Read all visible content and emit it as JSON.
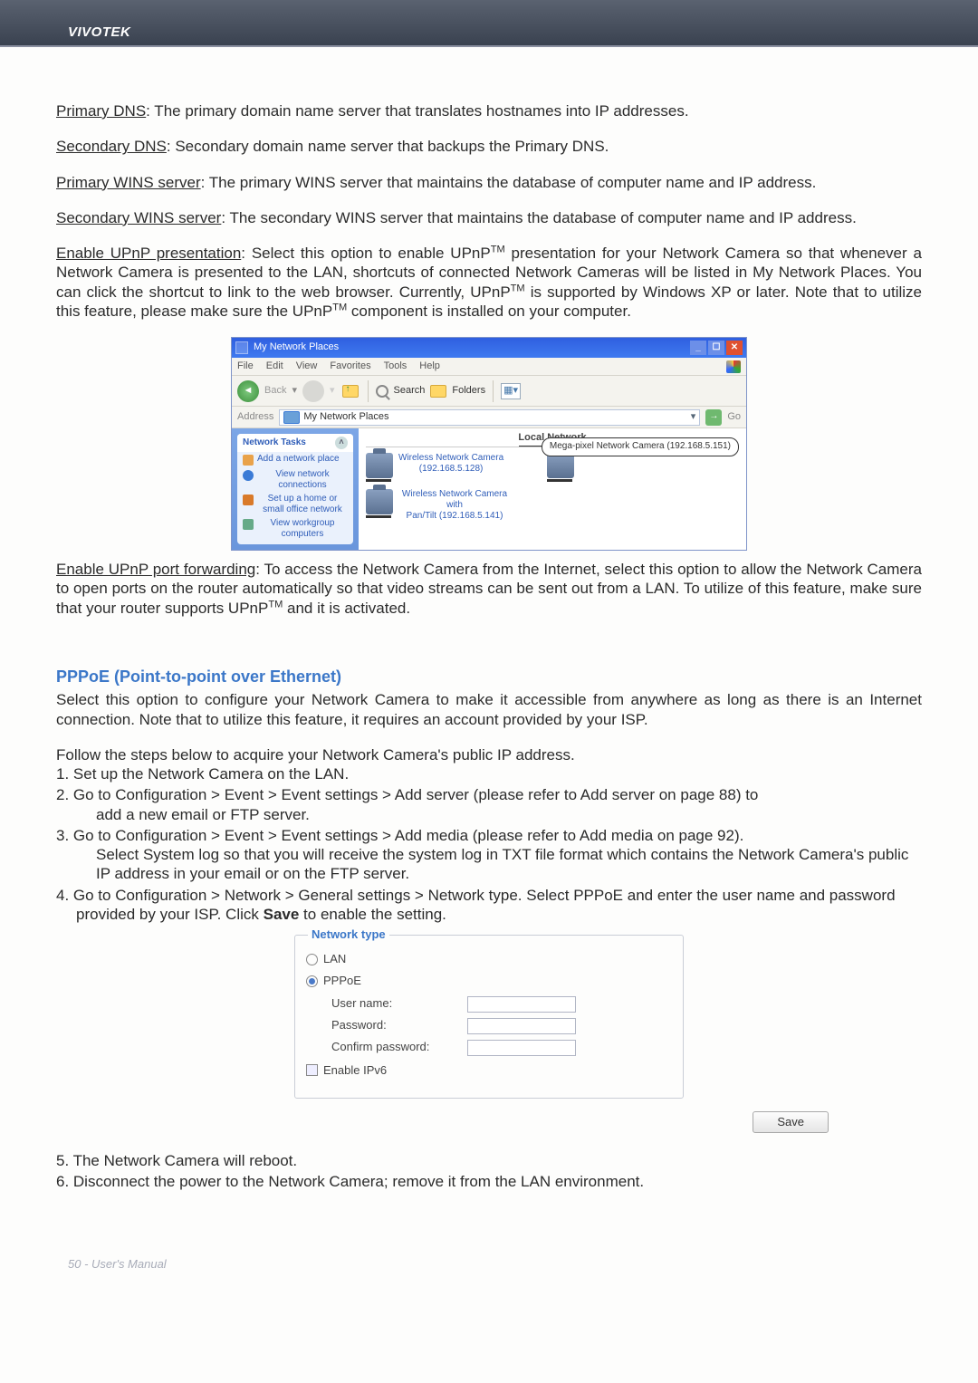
{
  "brand": "VIVOTEK",
  "paragraphs": {
    "primary_dns_label": "Primary DNS",
    "primary_dns_text": ": The primary domain name server that translates hostnames into IP addresses.",
    "secondary_dns_label": "Secondary DNS",
    "secondary_dns_text": ": Secondary domain name server that backups the Primary DNS.",
    "primary_wins_label": "Primary WINS server",
    "primary_wins_text": ": The primary WINS server that maintains the database of computer name and IP address.",
    "secondary_wins_label": "Secondary WINS server",
    "secondary_wins_text": ": The secondary WINS server that maintains the database of computer name and IP address.",
    "upnp_pres_label": "Enable UPnP presentation",
    "upnp_pres_text_a": ": Select this option to enable UPnP",
    "upnp_pres_text_b": " presentation for your Network Camera so that whenever a Network Camera is presented to the LAN, shortcuts of connected Network Cameras will be listed in My Network Places. You can click the shortcut to link to the web browser. Currently, UPnP",
    "upnp_pres_text_c": " is supported by Windows XP or later. Note that to utilize this feature, please make sure the UPnP",
    "upnp_pres_text_d": " component is installed on your computer.",
    "tm": "TM",
    "upnp_port_label": "Enable UPnP port forwarding",
    "upnp_port_text_a": ": To access the Network Camera from the Internet, select this option to allow the Network Camera to open ports on the router automatically so that video streams can be sent out from a LAN. To utilize of this feature, make sure that your router supports UPnP",
    "upnp_port_text_b": " and it is activated."
  },
  "pppoe": {
    "title": "PPPoE (Point-to-point over Ethernet)",
    "intro": "Select this option to configure your Network Camera to make it accessible from anywhere as long as there is an Internet connection. Note that to utilize this feature, it requires an account provided by your ISP.",
    "follow": "Follow the steps below to acquire your Network Camera's public IP address.",
    "steps": {
      "s1": "1. Set up the Network Camera on the LAN.",
      "s2a": "2. Go to Configuration > Event > Event settings > Add server (please refer to Add server on page 88) to",
      "s2b": "add a new email or FTP server.",
      "s3a": "3. Go to Configuration > Event > Event settings > Add media (please refer to Add media on page 92).",
      "s3b": "Select System log so that you will receive the system log in TXT file format which contains the Network Camera's public IP address in your email or on the FTP server.",
      "s4a": "4. Go to Configuration > Network > General settings > Network type. Select PPPoE and enter the user name and password provided by your ISP. Click ",
      "s4b": "Save",
      "s4c": " to enable the setting.",
      "s5": "5. The Network Camera will reboot.",
      "s6": "6. Disconnect the power to the Network Camera; remove it from the LAN environment."
    }
  },
  "win": {
    "title": "My Network Places",
    "menu": {
      "file": "File",
      "edit": "Edit",
      "view": "View",
      "favorites": "Favorites",
      "tools": "Tools",
      "help": "Help"
    },
    "toolbar": {
      "back": "Back",
      "search": "Search",
      "folders": "Folders"
    },
    "address_label": "Address",
    "address_value": "My Network Places",
    "go": "Go",
    "tasks_header": "Network Tasks",
    "tasks": {
      "t1": "Add a network place",
      "t2": "View network connections",
      "t3": "Set up a home or small office network",
      "t4": "View workgroup computers"
    },
    "section": "Local Network",
    "device1a": "Wireless Network Camera",
    "device1b": "(192.168.5.128)",
    "device2a": "Wireless Network Camera with",
    "device2b": "Pan/Tilt (192.168.5.141)",
    "callout": "Mega-pixel Network Camera (192.168.5.151)"
  },
  "form": {
    "legend": "Network type",
    "lan": "LAN",
    "pppoe": "PPPoE",
    "user": "User name:",
    "pass": "Password:",
    "confirm": "Confirm password:",
    "ipv6": "Enable IPv6",
    "save": "Save"
  },
  "footer": "50 - User's Manual"
}
